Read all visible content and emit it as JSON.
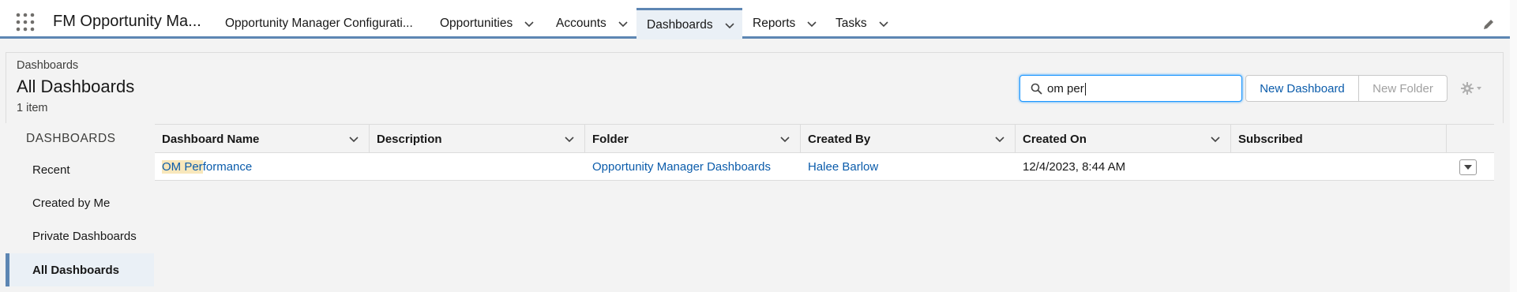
{
  "app": {
    "name": "FM Opportunity Ma..."
  },
  "nav": {
    "tabs": [
      {
        "label": "Opportunity Manager Configurati...",
        "has_menu": false
      },
      {
        "label": "Opportunities",
        "has_menu": true
      },
      {
        "label": "Accounts",
        "has_menu": true
      },
      {
        "label": "Dashboards",
        "has_menu": true,
        "active": true
      },
      {
        "label": "Reports",
        "has_menu": true
      },
      {
        "label": "Tasks",
        "has_menu": true
      }
    ]
  },
  "header": {
    "breadcrumb": "Dashboards",
    "title": "All Dashboards",
    "item_count": "1 item"
  },
  "search": {
    "value": "om per"
  },
  "buttons": {
    "new_dashboard": "New Dashboard",
    "new_folder": "New Folder"
  },
  "sidebar": {
    "heading": "DASHBOARDS",
    "items": [
      {
        "label": "Recent"
      },
      {
        "label": "Created by Me"
      },
      {
        "label": "Private Dashboards"
      },
      {
        "label": "All Dashboards",
        "active": true
      }
    ]
  },
  "table": {
    "columns": [
      "Dashboard Name",
      "Description",
      "Folder",
      "Created By",
      "Created On",
      "Subscribed"
    ],
    "rows": [
      {
        "name_highlight": "OM Per",
        "name_rest": "formance",
        "description": "",
        "folder": "Opportunity Manager Dashboards",
        "created_by": "Halee Barlow",
        "created_on": "12/4/2023, 8:44 AM",
        "subscribed": ""
      }
    ]
  },
  "colors": {
    "accent": "#5d86b3",
    "link": "#0b5cab",
    "highlight": "#f8e7bb"
  }
}
